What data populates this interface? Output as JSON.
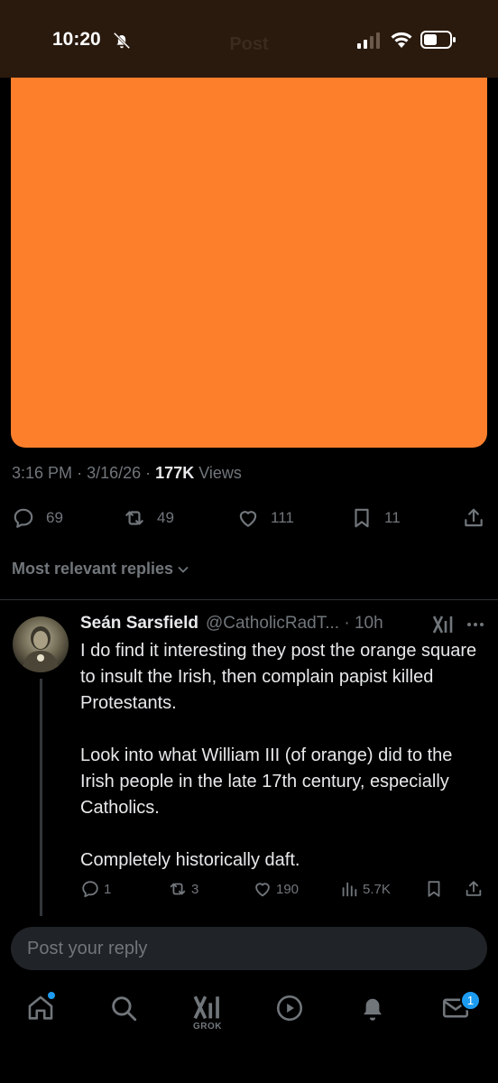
{
  "status_bar": {
    "time": "10:20",
    "icons": [
      "bell-off-icon",
      "signal-icon",
      "wifi-icon",
      "battery-icon"
    ]
  },
  "header": {
    "title": "Post"
  },
  "post": {
    "media_color": "#fd7f2c",
    "time": "3:16 PM",
    "date": "3/16/26",
    "views": "177K",
    "views_label": "Views",
    "separator": "·",
    "stats": {
      "replies": "69",
      "reposts": "49",
      "likes": "111",
      "bookmarks": "11"
    }
  },
  "replies_sort": {
    "label": "Most relevant replies"
  },
  "reply": {
    "name": "Seán Sarsfield",
    "handle": "@CatholicRadT...",
    "time_sep": "·",
    "age": "10h",
    "paragraphs": [
      "I do find it interesting they post the orange square to insult the Irish, then complain papist killed Protestants.",
      "Look into what William III (of orange) did  to the Irish people in the late 17th century, especially Catholics.",
      "Completely historically daft."
    ],
    "stats": {
      "replies": "1",
      "reposts": "3",
      "likes": "190",
      "views": "5.7K"
    }
  },
  "compose": {
    "placeholder": "Post your reply"
  },
  "bottom_nav": {
    "grok_label": "GROK",
    "messages_badge": "1",
    "accent": "#1d9bf0"
  }
}
